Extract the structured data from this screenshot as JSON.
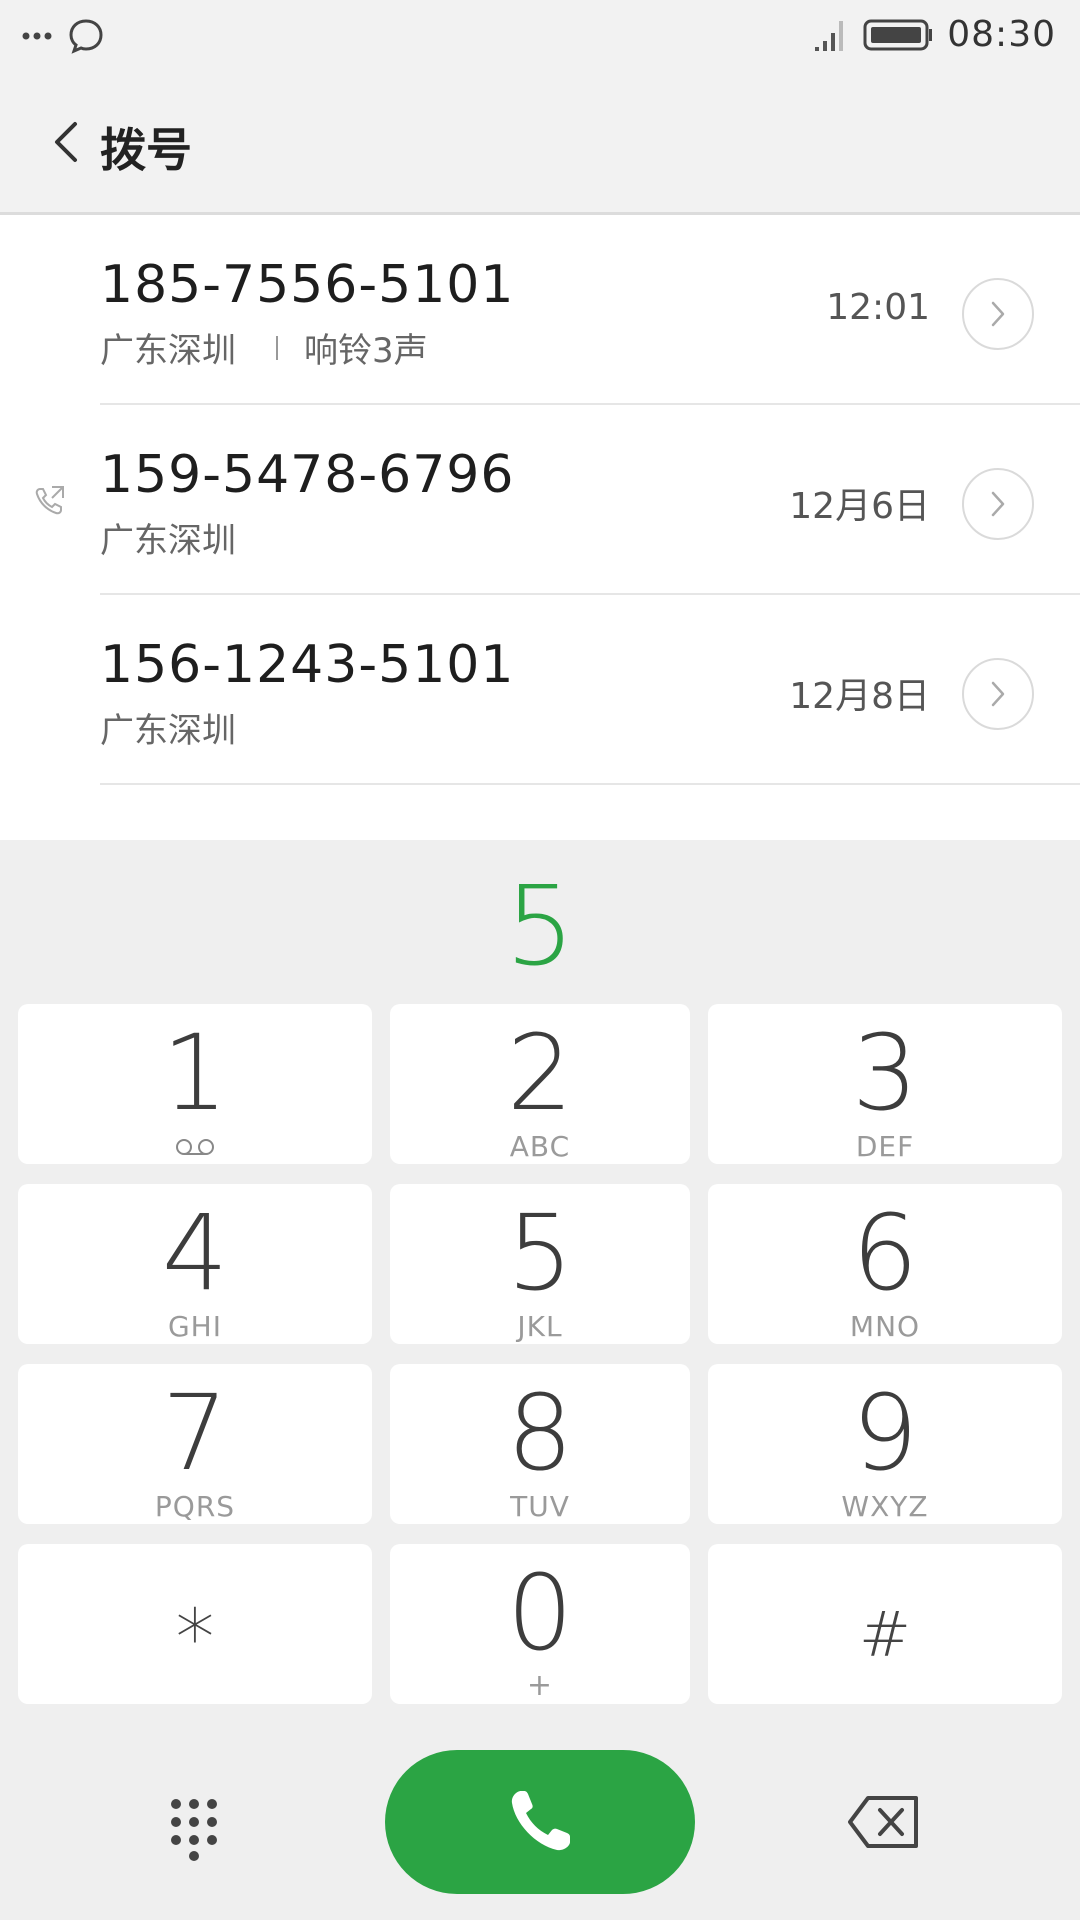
{
  "status_bar": {
    "time": "08:30",
    "icons": [
      "more-dots-icon",
      "chat-bubble-icon",
      "signal-icon",
      "battery-icon"
    ]
  },
  "header": {
    "title": "拨号",
    "back_icon": "chevron-left-icon"
  },
  "call_log": [
    {
      "number": "185-7556-5101",
      "location": "广东深圳",
      "note": "响铃3声",
      "time": "12:01",
      "outgoing": false
    },
    {
      "number": "159-5478-6796",
      "location": "广东深圳",
      "note": "",
      "time": "12月6日",
      "outgoing": true
    },
    {
      "number": "156-1243-5101",
      "location": "广东深圳",
      "note": "",
      "time": "12月8日",
      "outgoing": false
    }
  ],
  "dial": {
    "digits": "5",
    "accent_color": "#2ba444"
  },
  "keypad": {
    "k1": {
      "digit": "1",
      "letters": ""
    },
    "k2": {
      "digit": "2",
      "letters": "ABC"
    },
    "k3": {
      "digit": "3",
      "letters": "DEF"
    },
    "k4": {
      "digit": "4",
      "letters": "GHI"
    },
    "k5": {
      "digit": "5",
      "letters": "JKL"
    },
    "k6": {
      "digit": "6",
      "letters": "MNO"
    },
    "k7": {
      "digit": "7",
      "letters": "PQRS"
    },
    "k8": {
      "digit": "8",
      "letters": "TUV"
    },
    "k9": {
      "digit": "9",
      "letters": "WXYZ"
    },
    "kstar": {
      "digit": "*",
      "letters": ""
    },
    "k0": {
      "digit": "0",
      "letters": "+"
    },
    "khash": {
      "digit": "#",
      "letters": ""
    }
  },
  "bottom_bar": {
    "icons": [
      "keypad-toggle-icon",
      "phone-icon",
      "backspace-icon"
    ]
  }
}
